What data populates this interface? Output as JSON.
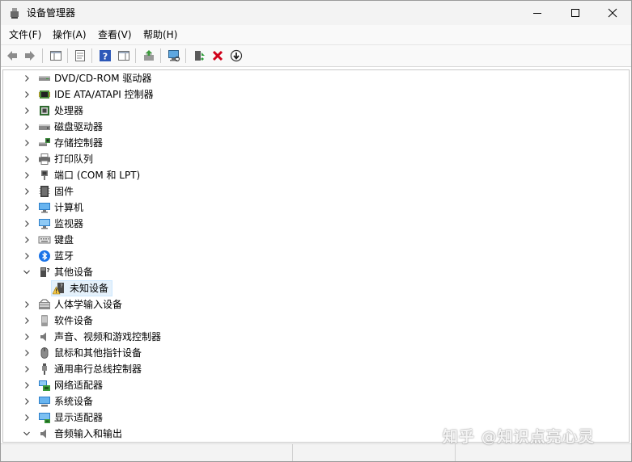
{
  "window": {
    "title": "设备管理器",
    "controls": {
      "minimize": "minimize-icon",
      "maximize": "maximize-icon",
      "close": "close-icon"
    }
  },
  "menu": [
    {
      "label": "文件(F)"
    },
    {
      "label": "操作(A)"
    },
    {
      "label": "查看(V)"
    },
    {
      "label": "帮助(H)"
    }
  ],
  "toolbar": {
    "icons": [
      "back-icon",
      "forward-icon",
      "show-hide-tree-icon",
      "properties-icon",
      "help-icon",
      "action-pane-icon",
      "update-driver-icon",
      "scan-hardware-icon",
      "enable-device-icon",
      "uninstall-device-icon",
      "disable-device-icon"
    ]
  },
  "tree": [
    {
      "label": "DVD/CD-ROM 驱动器",
      "icon": "dvd-drive-icon",
      "expanded": false
    },
    {
      "label": "IDE ATA/ATAPI 控制器",
      "icon": "ide-controller-icon",
      "expanded": false
    },
    {
      "label": "处理器",
      "icon": "processor-icon",
      "expanded": false
    },
    {
      "label": "磁盘驱动器",
      "icon": "disk-drive-icon",
      "expanded": false
    },
    {
      "label": "存储控制器",
      "icon": "storage-controller-icon",
      "expanded": false
    },
    {
      "label": "打印队列",
      "icon": "printer-icon",
      "expanded": false
    },
    {
      "label": "端口 (COM 和 LPT)",
      "icon": "port-icon",
      "expanded": false
    },
    {
      "label": "固件",
      "icon": "firmware-icon",
      "expanded": false
    },
    {
      "label": "计算机",
      "icon": "computer-icon",
      "expanded": false
    },
    {
      "label": "监视器",
      "icon": "monitor-icon",
      "expanded": false
    },
    {
      "label": "键盘",
      "icon": "keyboard-icon",
      "expanded": false
    },
    {
      "label": "蓝牙",
      "icon": "bluetooth-icon",
      "expanded": false
    },
    {
      "label": "其他设备",
      "icon": "other-devices-icon",
      "expanded": true
    },
    {
      "label": "未知设备",
      "icon": "unknown-device-warning-icon",
      "child": true,
      "selected": true
    },
    {
      "label": "人体学输入设备",
      "icon": "hid-icon",
      "expanded": false
    },
    {
      "label": "软件设备",
      "icon": "software-device-icon",
      "expanded": false
    },
    {
      "label": "声音、视频和游戏控制器",
      "icon": "sound-icon",
      "expanded": false
    },
    {
      "label": "鼠标和其他指针设备",
      "icon": "mouse-icon",
      "expanded": false
    },
    {
      "label": "通用串行总线控制器",
      "icon": "usb-icon",
      "expanded": false
    },
    {
      "label": "网络适配器",
      "icon": "network-adapter-icon",
      "expanded": false
    },
    {
      "label": "系统设备",
      "icon": "system-device-icon",
      "expanded": false
    },
    {
      "label": "显示适配器",
      "icon": "display-adapter-icon",
      "expanded": false
    },
    {
      "label": "音频输入和输出",
      "icon": "audio-io-icon",
      "expanded": true
    }
  ],
  "watermark": "知乎 @知识点亮心灵",
  "colors": {
    "accent": "#0078d4",
    "selection": "#e5f1fb",
    "warning": "#f7c948",
    "delete": "#d0021b"
  }
}
